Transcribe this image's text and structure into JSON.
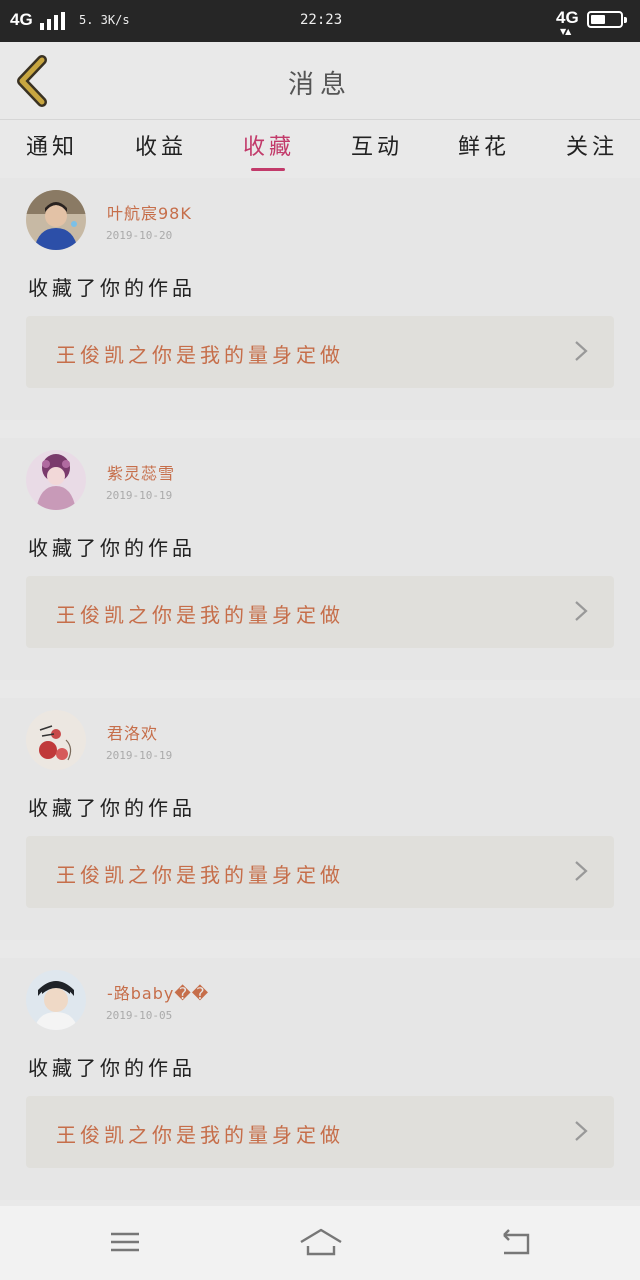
{
  "status_bar": {
    "network": "4G",
    "speed": "5. 3K/s",
    "time": "22:23",
    "network_right": "4G",
    "data_arrows": "▼▲",
    "battery_level": 0.55
  },
  "header": {
    "title": "消息"
  },
  "tabs": [
    {
      "label": "通知",
      "active": false
    },
    {
      "label": "收益",
      "active": false
    },
    {
      "label": "收藏",
      "active": true
    },
    {
      "label": "互动",
      "active": false
    },
    {
      "label": "鲜花",
      "active": false
    },
    {
      "label": "关注",
      "active": false
    }
  ],
  "notifications": [
    {
      "username": "叶航宸98K",
      "date": "2019-10-20",
      "action": "收藏了你的作品",
      "work_title": "王俊凯之你是我的量身定做"
    },
    {
      "username": "紫灵蕊雪",
      "date": "2019-10-19",
      "action": "收藏了你的作品",
      "work_title": "王俊凯之你是我的量身定做"
    },
    {
      "username": "君洛欢",
      "date": "2019-10-19",
      "action": "收藏了你的作品",
      "work_title": "王俊凯之你是我的量身定做"
    },
    {
      "username": "-路baby��",
      "date": "2019-10-05",
      "action": "收藏了你的作品",
      "work_title": "王俊凯之你是我的量身定做"
    }
  ],
  "colors": {
    "accent": "#c23a6a",
    "name_color": "#c66e4a"
  },
  "icons": {
    "back": "chevron-left-icon",
    "work_arrow": "chevron-right-icon",
    "menu": "menu-icon",
    "home": "home-icon",
    "back_nav": "back-arrow-icon"
  }
}
